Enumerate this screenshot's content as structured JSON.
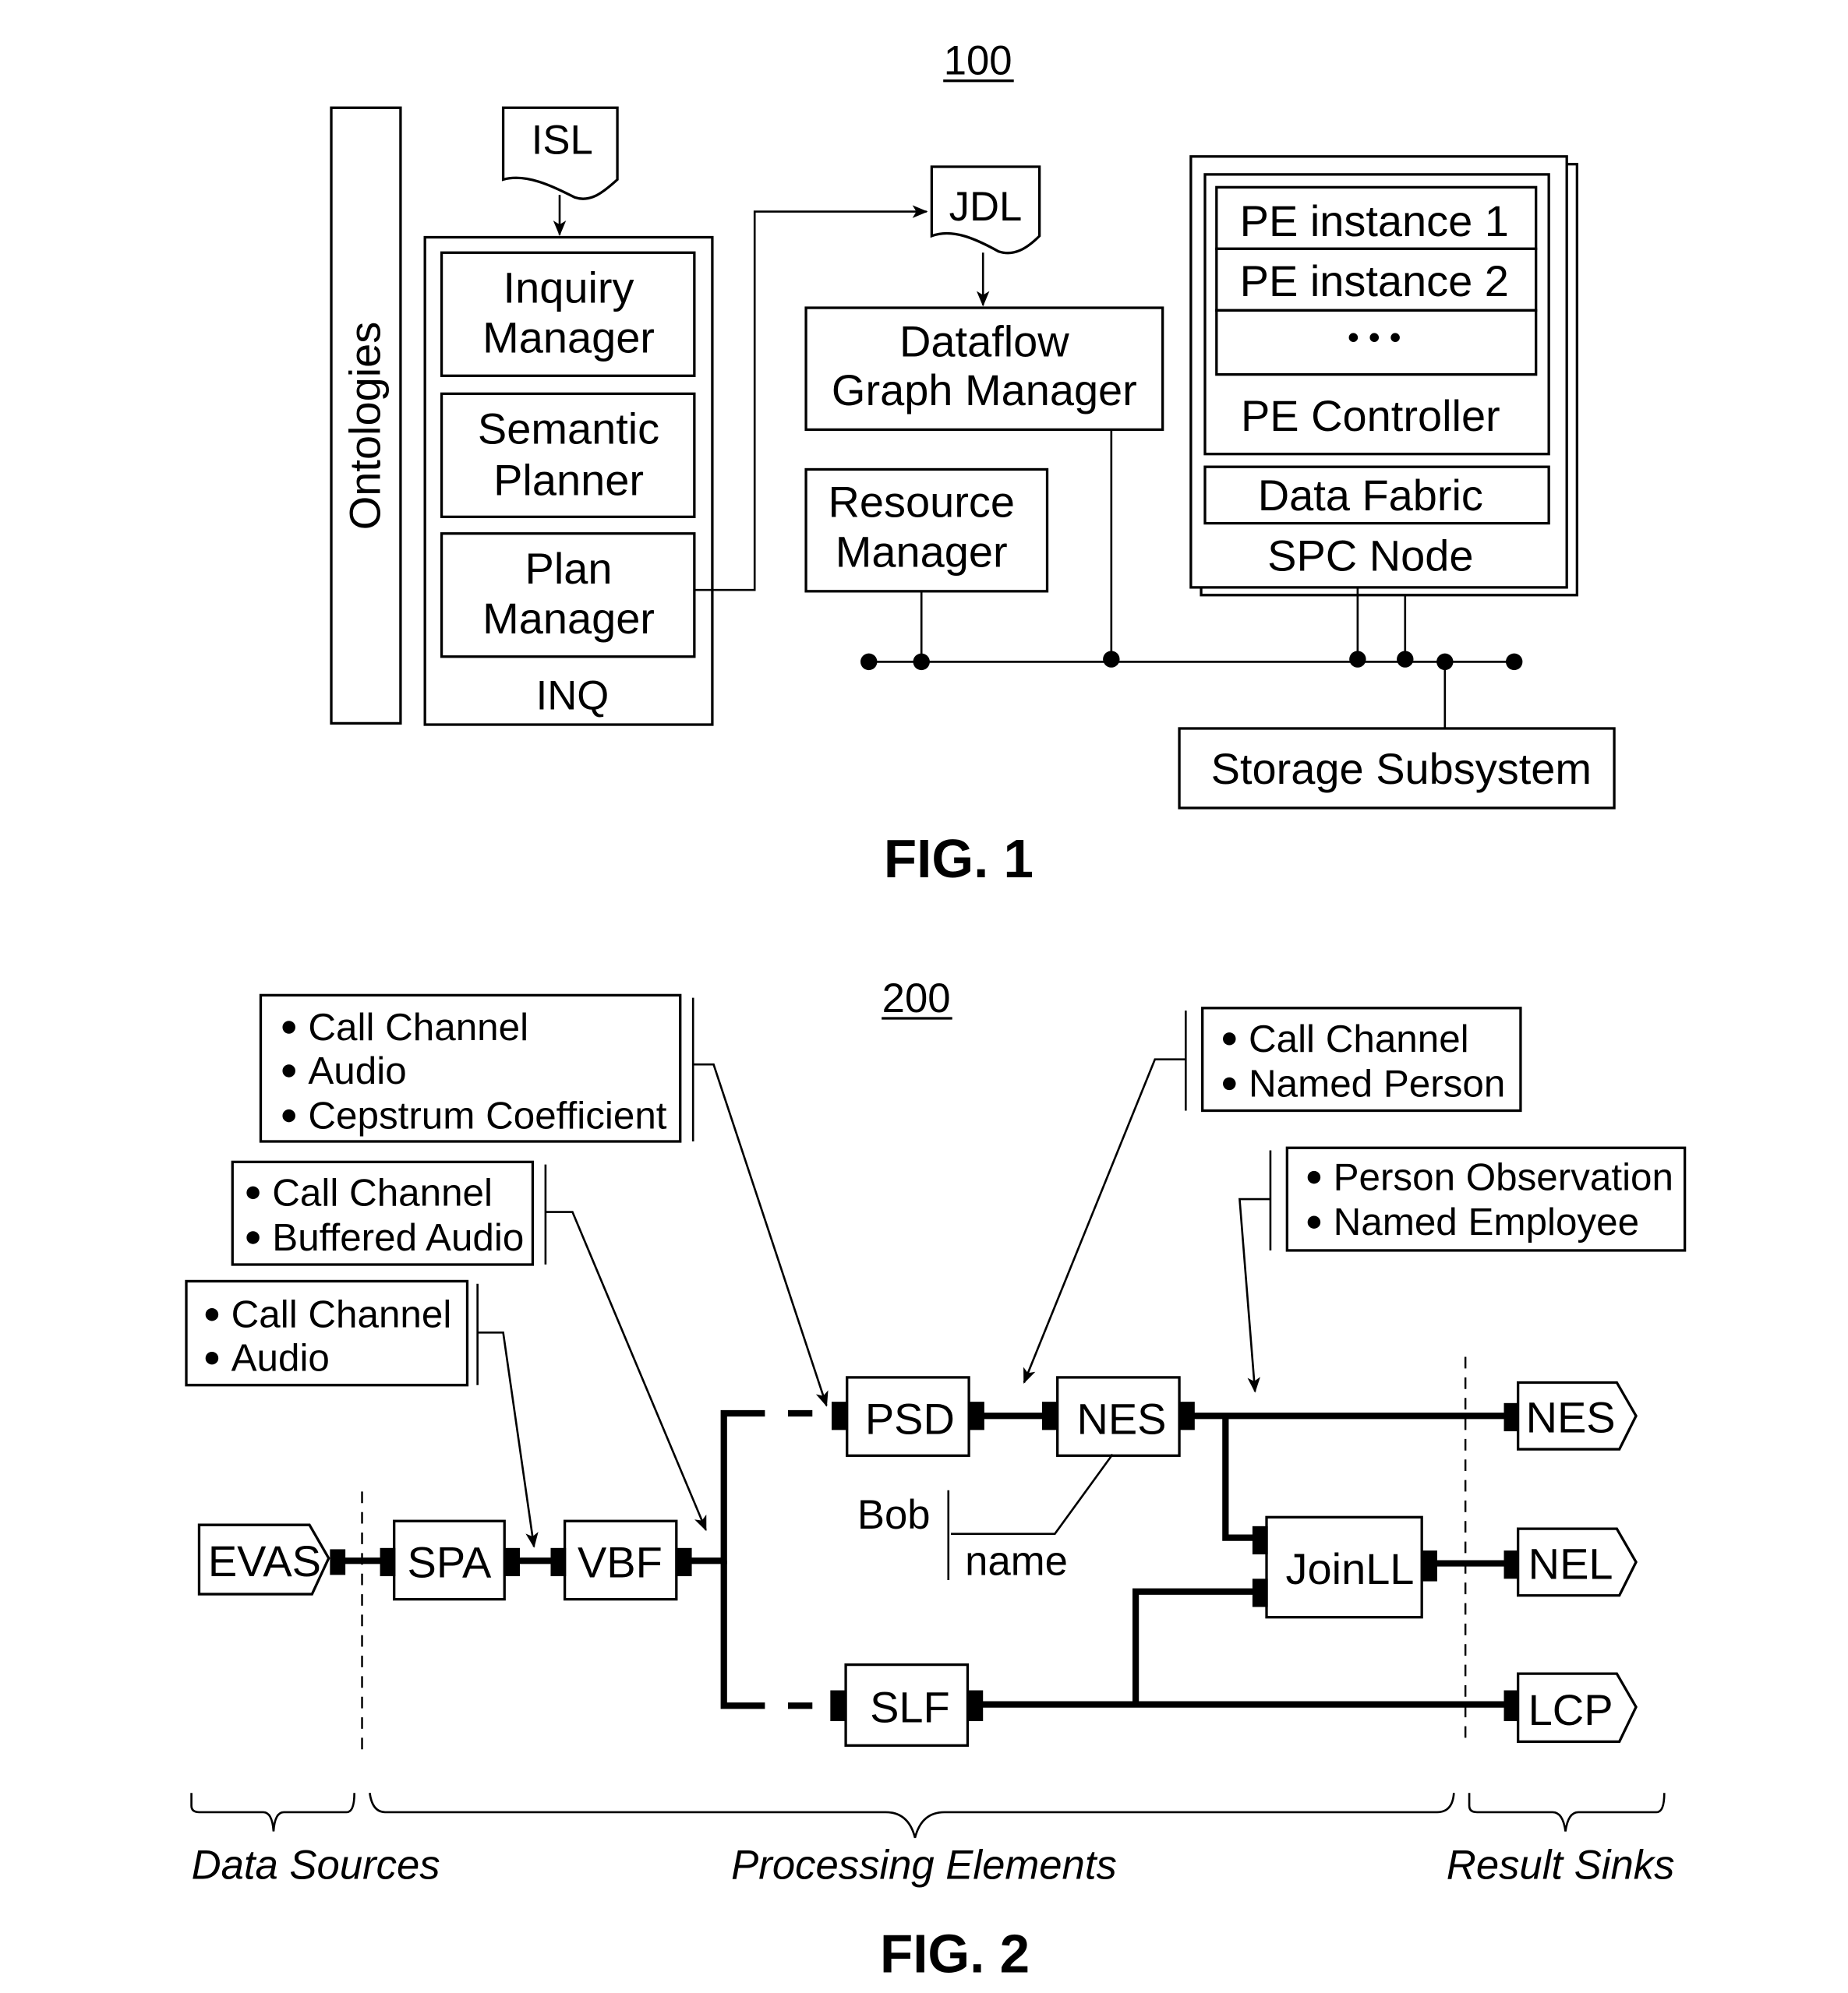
{
  "fig1": {
    "ref_number": "100",
    "caption": "FIG. 1",
    "ontologies": "Ontologies",
    "isl": "ISL",
    "jdl": "JDL",
    "inq": {
      "label": "INQ",
      "inquiry_manager": [
        "Inquiry",
        "Manager"
      ],
      "semantic_planner": [
        "Semantic",
        "Planner"
      ],
      "plan_manager": [
        "Plan",
        "Manager"
      ]
    },
    "dataflow_graph_manager": [
      "Dataflow",
      "Graph Manager"
    ],
    "resource_manager": [
      "Resource",
      "Manager"
    ],
    "spc_node": {
      "label": "SPC Node",
      "pe_instances": [
        "PE instance 1",
        "PE instance 2",
        "• • •"
      ],
      "pe_controller": "PE Controller",
      "data_fabric": "Data Fabric"
    },
    "storage_subsystem": "Storage Subsystem"
  },
  "fig2": {
    "ref_number": "200",
    "caption": "FIG. 2",
    "annotations": {
      "cepstrum": [
        "Call Channel",
        "Audio",
        "Cepstrum Coefficient"
      ],
      "buffered": [
        "Call Channel",
        "Buffered Audio"
      ],
      "audio": [
        "Call Channel",
        "Audio"
      ],
      "named_person": [
        "Call Channel",
        "Named Person"
      ],
      "employee": [
        "Person Observation",
        "Named Employee"
      ]
    },
    "sources": [
      "EVAS"
    ],
    "elements": [
      "SPA",
      "VBF",
      "PSD",
      "NES",
      "SLF",
      "JoinLL"
    ],
    "sinks": [
      "NES",
      "NEL",
      "LCP"
    ],
    "bob": "Bob",
    "name": "name",
    "groups": [
      "Data Sources",
      "Processing Elements",
      "Result Sinks"
    ]
  }
}
